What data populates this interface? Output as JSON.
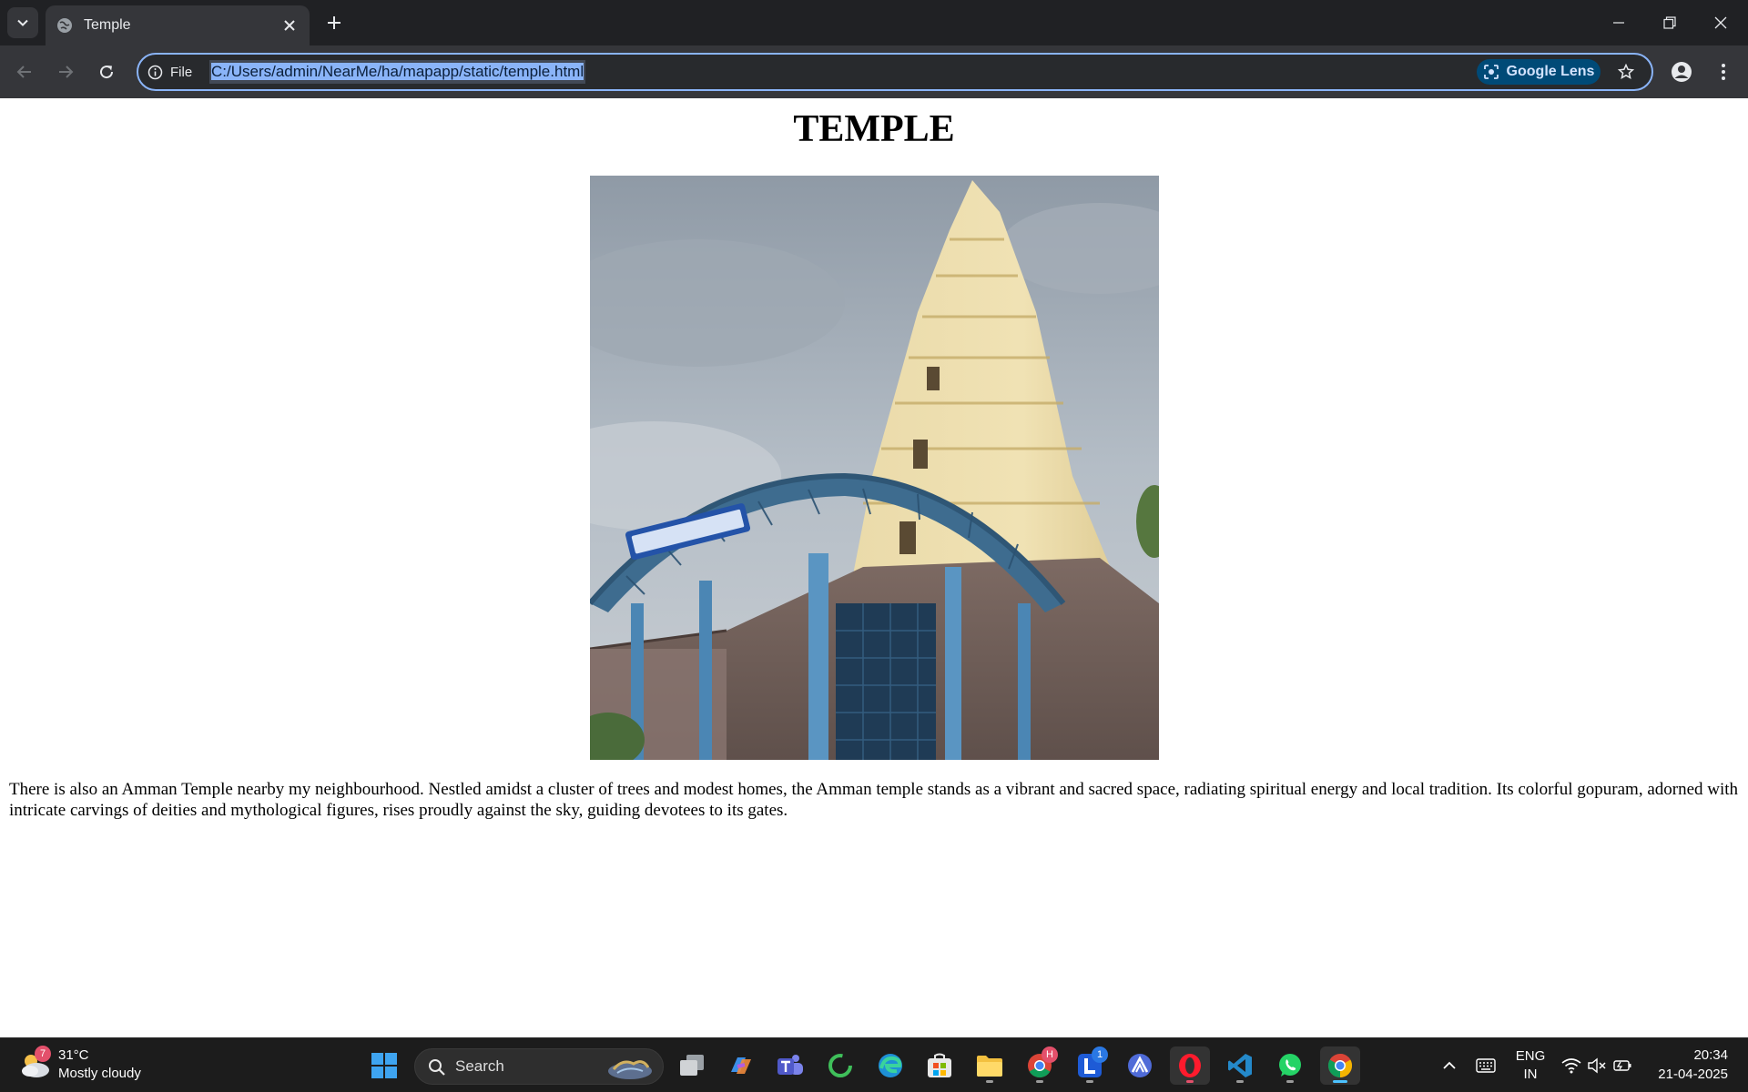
{
  "browser": {
    "tab": {
      "title": "Temple"
    },
    "address": {
      "scheme_label": "File",
      "url": "C:/Users/admin/NearMe/ha/mapapp/static/temple.html"
    },
    "lens_label": "Google Lens"
  },
  "page": {
    "heading": "TEMPLE",
    "description": "There is also an Amman Temple nearby my neighbourhood. Nestled amidst a cluster of trees and modest homes, the Amman temple stands as a vibrant and sacred space, radiating spiritual energy and local tradition. Its colorful gopuram, adorned with intricate carvings of deities and mythological figures, rises proudly against the sky, guiding devotees to its gates."
  },
  "taskbar": {
    "weather": {
      "temp": "31°C",
      "condition": "Mostly cloudy",
      "badge": "7"
    },
    "search_label": "Search",
    "app_badges": {
      "chrome_profile": "H",
      "l_app": "1"
    },
    "tray": {
      "lang_top": "ENG",
      "lang_bottom": "IN"
    },
    "clock": {
      "time": "20:34",
      "date": "21-04-2025"
    }
  },
  "colors": {
    "accent": "#8ab4f8",
    "tab_bg": "#35363a",
    "titlebar_bg": "#202124",
    "taskbar_bg": "#1c1c1c"
  }
}
